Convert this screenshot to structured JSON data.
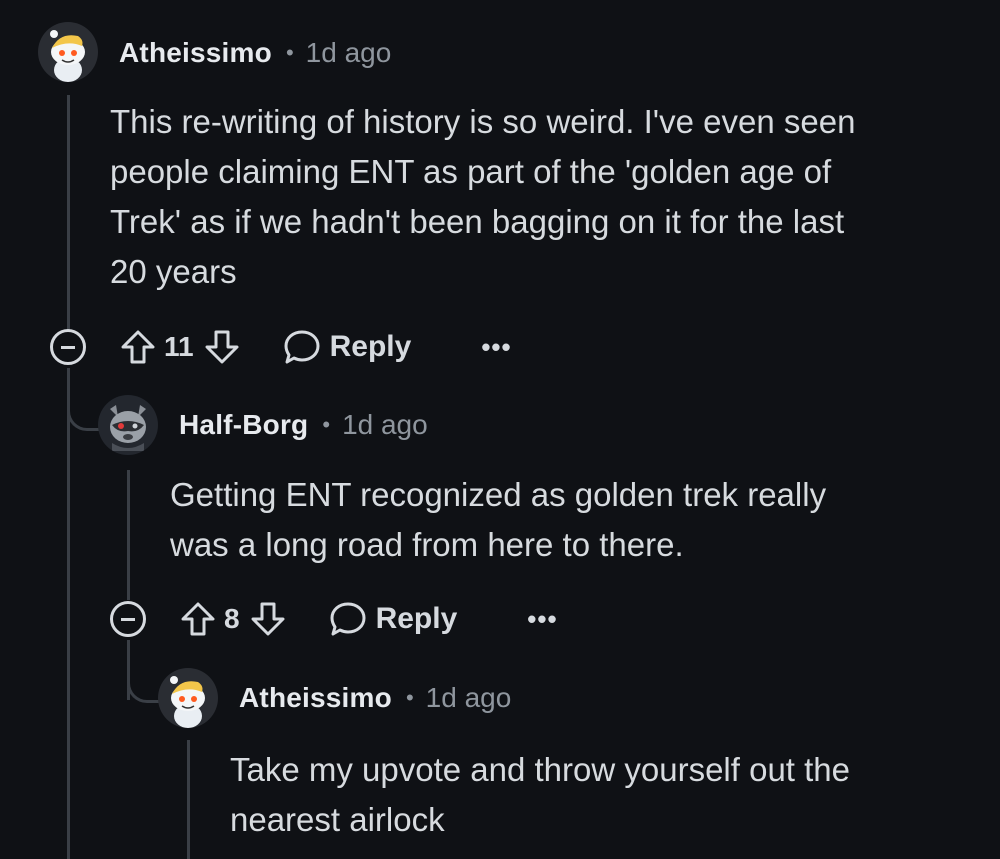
{
  "comments": [
    {
      "author": "Atheissimo",
      "separator": "•",
      "time": "1d ago",
      "body": "This re-writing of history is so weird. I've even seen\npeople claiming ENT as part of the 'golden age of\nTrek' as if we hadn't been bagging on it for the last\n20 years",
      "score": "11",
      "reply_label": "Reply",
      "more_label": "•••"
    },
    {
      "author": "Half-Borg",
      "separator": "•",
      "time": "1d ago",
      "body": "Getting ENT recognized as golden trek really\nwas a long road from here to there.",
      "score": "8",
      "reply_label": "Reply",
      "more_label": "•••"
    },
    {
      "author": "Atheissimo",
      "separator": "•",
      "time": "1d ago",
      "body": "Take my upvote and throw yourself out the\nnearest airlock"
    }
  ],
  "colors": {
    "background": "#0f1115",
    "thread_line": "#3a3f46",
    "text": "#d7dbdf",
    "muted": "#8f969e"
  }
}
